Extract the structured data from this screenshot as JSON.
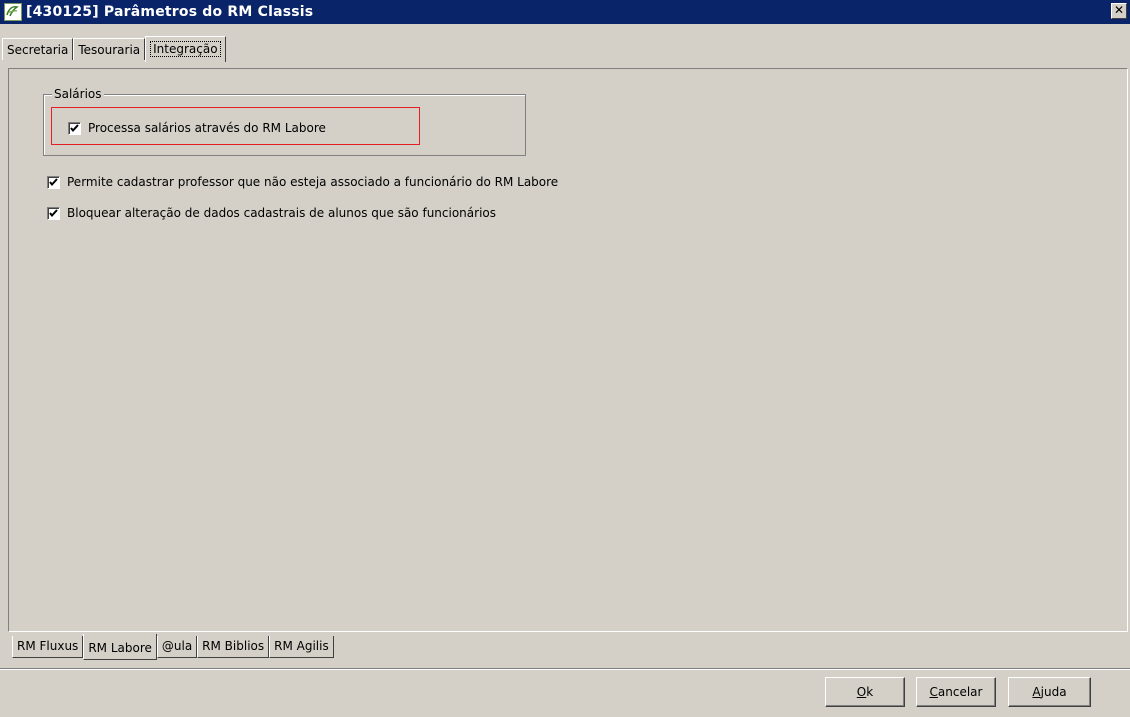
{
  "window": {
    "title": "[430125] Parâmetros do RM Classis",
    "close_label": "✕"
  },
  "top_tabs": [
    {
      "label": "Secretaria",
      "active": false
    },
    {
      "label": "Tesouraria",
      "active": false
    },
    {
      "label": "Integração",
      "active": true
    }
  ],
  "group": {
    "label": "Salários",
    "checkbox": {
      "label": "Processa salários através do RM Labore",
      "checked": true
    }
  },
  "options": [
    {
      "label": "Permite cadastrar professor que não esteja associado a funcionário do RM Labore",
      "checked": true
    },
    {
      "label": "Bloquear alteração de dados cadastrais de alunos que são funcionários",
      "checked": true
    }
  ],
  "bottom_tabs": [
    {
      "label": "RM Fluxus",
      "active": false
    },
    {
      "label": "RM Labore",
      "active": true
    },
    {
      "label": "@ula",
      "active": false
    },
    {
      "label": "RM Biblios",
      "active": false
    },
    {
      "label": "RM Agilis",
      "active": false
    }
  ],
  "buttons": {
    "ok": {
      "mnemonic": "O",
      "rest": "k"
    },
    "cancel": {
      "mnemonic": "C",
      "rest": "ancelar"
    },
    "help": {
      "mnemonic": "A",
      "rest": "juda"
    }
  },
  "colors": {
    "titlebar": "#0a246a",
    "face": "#d4d0c8",
    "highlight_border": "#e81e25"
  }
}
